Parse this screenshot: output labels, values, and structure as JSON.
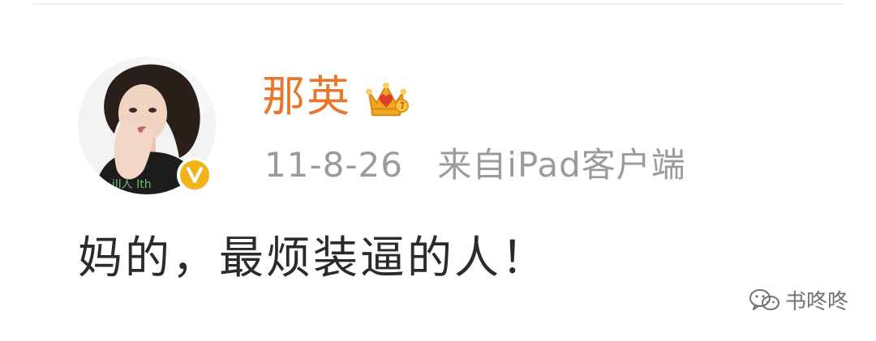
{
  "post": {
    "username": "那英",
    "date": "11-8-26",
    "source": "来自iPad客户端",
    "content": "妈的，最烦装逼的人！"
  },
  "avatar_text": "ill人 Ith",
  "watermark": {
    "label": "书咚咚",
    "icon": "wechat-icon"
  },
  "badges": {
    "crown": "crown-icon",
    "verified": "verified-icon"
  },
  "colors": {
    "username": "#e8772e",
    "meta": "#9b9b9b",
    "content": "#2b2b2b",
    "verified": "#f3b31a",
    "crown": "#f0a81e"
  }
}
